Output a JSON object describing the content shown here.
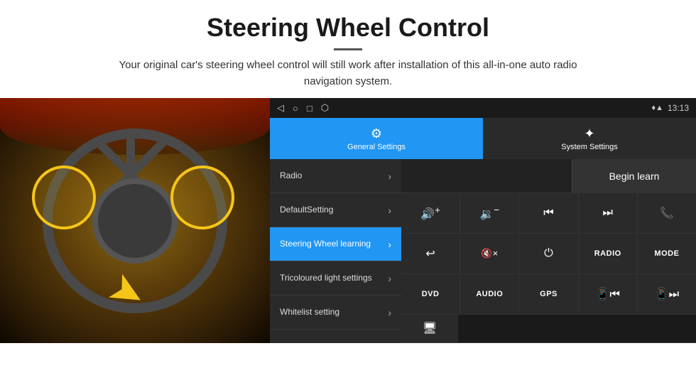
{
  "header": {
    "title": "Steering Wheel Control",
    "divider": "—",
    "subtitle": "Your original car's steering wheel control will still work after installation of this all-in-one auto radio navigation system."
  },
  "statusBar": {
    "navIcons": [
      "◁",
      "○",
      "□",
      "⬡"
    ],
    "signalIcons": "♦ ▲",
    "time": "13:13"
  },
  "tabs": [
    {
      "id": "general",
      "label": "General Settings",
      "icon": "⚙",
      "active": true
    },
    {
      "id": "system",
      "label": "System Settings",
      "icon": "✦",
      "active": false
    }
  ],
  "menu": [
    {
      "id": "radio",
      "label": "Radio",
      "active": false
    },
    {
      "id": "default-setting",
      "label": "DefaultSetting",
      "active": false
    },
    {
      "id": "steering-wheel",
      "label": "Steering Wheel learning",
      "active": true
    },
    {
      "id": "tricoloured",
      "label": "Tricoloured light settings",
      "active": false
    },
    {
      "id": "whitelist",
      "label": "Whitelist setting",
      "active": false
    }
  ],
  "controls": {
    "beginLearnLabel": "Begin learn",
    "rows": [
      [
        {
          "id": "vol-up",
          "icon": "🔊+",
          "type": "icon"
        },
        {
          "id": "vol-down",
          "icon": "🔉−",
          "type": "icon"
        },
        {
          "id": "prev-track",
          "icon": "⏮",
          "type": "icon"
        },
        {
          "id": "next-track",
          "icon": "⏭",
          "type": "icon"
        },
        {
          "id": "phone",
          "icon": "📞",
          "type": "icon"
        }
      ],
      [
        {
          "id": "call-end",
          "icon": "↩",
          "type": "icon"
        },
        {
          "id": "mute",
          "icon": "🔇×",
          "type": "icon"
        },
        {
          "id": "power",
          "icon": "⏻",
          "type": "icon"
        },
        {
          "id": "radio-btn",
          "label": "RADIO",
          "type": "text"
        },
        {
          "id": "mode-btn",
          "label": "MODE",
          "type": "text"
        }
      ],
      [
        {
          "id": "dvd-btn",
          "label": "DVD",
          "type": "text"
        },
        {
          "id": "audio-btn",
          "label": "AUDIO",
          "type": "text"
        },
        {
          "id": "gps-btn",
          "label": "GPS",
          "type": "text"
        },
        {
          "id": "tel-prev",
          "icon": "📱⏮",
          "type": "icon"
        },
        {
          "id": "tel-next",
          "icon": "📱⏭",
          "type": "icon"
        }
      ],
      [
        {
          "id": "screen-btn",
          "icon": "🖥",
          "type": "icon"
        }
      ]
    ]
  }
}
